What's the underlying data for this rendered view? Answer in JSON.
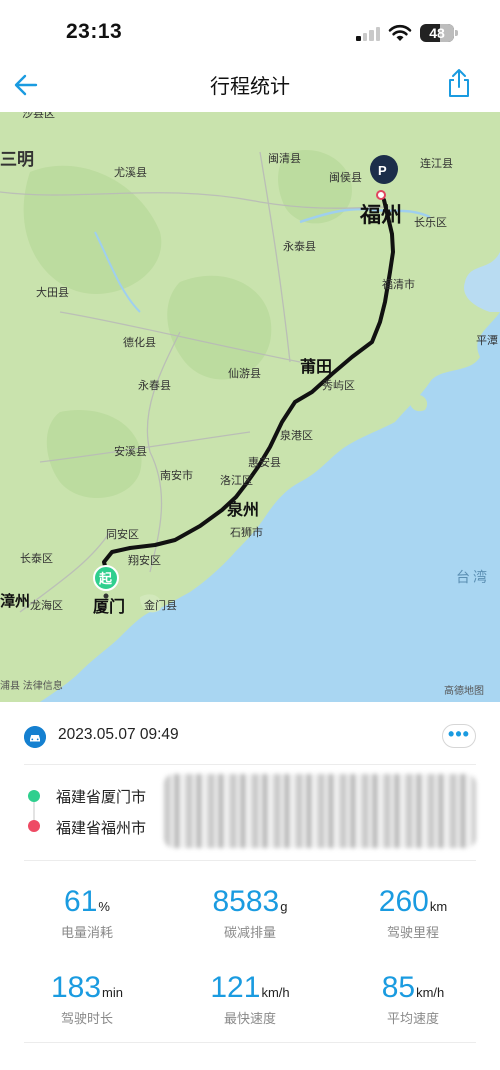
{
  "status_bar": {
    "time": "23:13",
    "battery": "48"
  },
  "header": {
    "title": "行程统计"
  },
  "map": {
    "labels": {
      "sanming": "三明",
      "shaxian": "沙县区",
      "youxi": "尤溪县",
      "minqing": "闽清县",
      "minhou": "闽侯县",
      "lianjiang": "连江县",
      "fuzhou": "福州",
      "changle": "长乐区",
      "yongtai": "永泰县",
      "datian": "大田县",
      "fuqing": "福清市",
      "pingtan": "平潭",
      "dehua": "德化县",
      "putian": "莆田",
      "xianyou": "仙游县",
      "yongchun": "永春县",
      "xiuyu": "秀屿区",
      "quangang": "泉港区",
      "anxi": "安溪县",
      "huian": "惠安县",
      "nanan": "南安市",
      "luojiang": "洛江区",
      "quanzhou": "泉州",
      "shishi": "石狮市",
      "tongan": "同安区",
      "xiangan": "翔安区",
      "changtai": "长泰区",
      "zhangzhou": "漳州",
      "longhai": "龙海区",
      "xiamen": "厦门",
      "jinmen": "金门县",
      "taiwan": "台湾",
      "start_marker": "起",
      "end_marker": "P",
      "copyright_left": "浦县 法律信息",
      "copyright_right": "高德地图"
    },
    "colors": {
      "land": "#c9e3ad",
      "sea": "#a9d6f2",
      "route": "#111111",
      "start": "#2fcf8e",
      "end": "#1c2e4a"
    }
  },
  "trip": {
    "datetime": "2023.05.07 09:49",
    "more_label": "•••",
    "start_location": "福建省厦门市",
    "end_location": "福建省福州市"
  },
  "stats": [
    {
      "value": "61",
      "unit": "%",
      "label": "电量消耗"
    },
    {
      "value": "8583",
      "unit": "g",
      "label": "碳减排量"
    },
    {
      "value": "260",
      "unit": "km",
      "label": "驾驶里程"
    },
    {
      "value": "183",
      "unit": "min",
      "label": "驾驶时长"
    },
    {
      "value": "121",
      "unit": "km/h",
      "label": "最快速度"
    },
    {
      "value": "85",
      "unit": "km/h",
      "label": "平均速度"
    }
  ]
}
